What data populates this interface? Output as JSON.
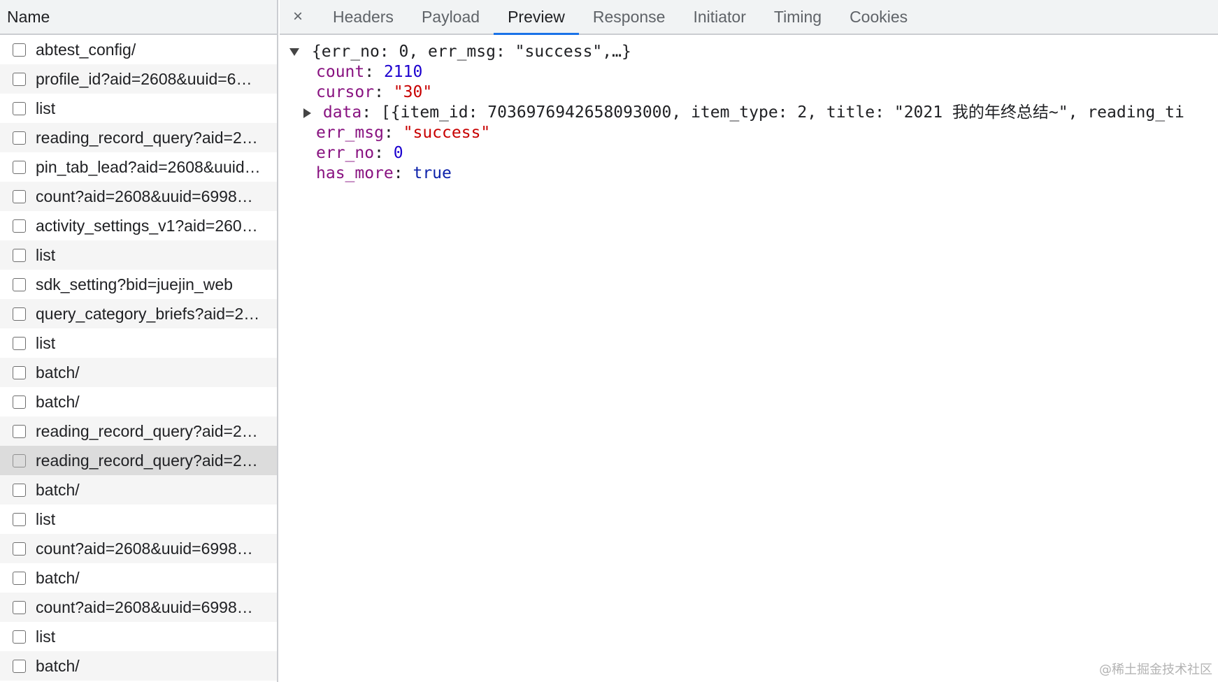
{
  "list": {
    "header": "Name",
    "rows": [
      {
        "name": "abtest_config/"
      },
      {
        "name": "profile_id?aid=2608&uuid=6…"
      },
      {
        "name": "list"
      },
      {
        "name": "reading_record_query?aid=2…"
      },
      {
        "name": "pin_tab_lead?aid=2608&uuid…"
      },
      {
        "name": "count?aid=2608&uuid=6998…"
      },
      {
        "name": "activity_settings_v1?aid=260…"
      },
      {
        "name": "list"
      },
      {
        "name": "sdk_setting?bid=juejin_web"
      },
      {
        "name": "query_category_briefs?aid=2…"
      },
      {
        "name": "list"
      },
      {
        "name": "batch/"
      },
      {
        "name": "batch/"
      },
      {
        "name": "reading_record_query?aid=2…"
      },
      {
        "name": "reading_record_query?aid=2…",
        "selected": true
      },
      {
        "name": "batch/"
      },
      {
        "name": "list"
      },
      {
        "name": "count?aid=2608&uuid=6998…"
      },
      {
        "name": "batch/"
      },
      {
        "name": "count?aid=2608&uuid=6998…"
      },
      {
        "name": "list"
      },
      {
        "name": "batch/"
      }
    ]
  },
  "tabs": {
    "close": "×",
    "items": [
      {
        "id": "headers",
        "label": "Headers"
      },
      {
        "id": "payload",
        "label": "Payload"
      },
      {
        "id": "preview",
        "label": "Preview",
        "active": true
      },
      {
        "id": "response",
        "label": "Response"
      },
      {
        "id": "initiator",
        "label": "Initiator"
      },
      {
        "id": "timing",
        "label": "Timing"
      },
      {
        "id": "cookies",
        "label": "Cookies"
      }
    ]
  },
  "preview": {
    "summary": "{err_no: 0, err_msg: \"success\",…}",
    "fields": {
      "count": {
        "key": "count",
        "value": "2110"
      },
      "cursor": {
        "key": "cursor",
        "value": "\"30\""
      },
      "data": {
        "key": "data",
        "value": "[{item_id: 7036976942658093000, item_type: 2, title: \"2021 我的年终总结~\", reading_ti"
      },
      "err_msg": {
        "key": "err_msg",
        "value": "\"success\""
      },
      "err_no": {
        "key": "err_no",
        "value": "0"
      },
      "has_more": {
        "key": "has_more",
        "value": "true"
      }
    },
    "colon": ": "
  },
  "watermark": "@稀土掘金技术社区"
}
